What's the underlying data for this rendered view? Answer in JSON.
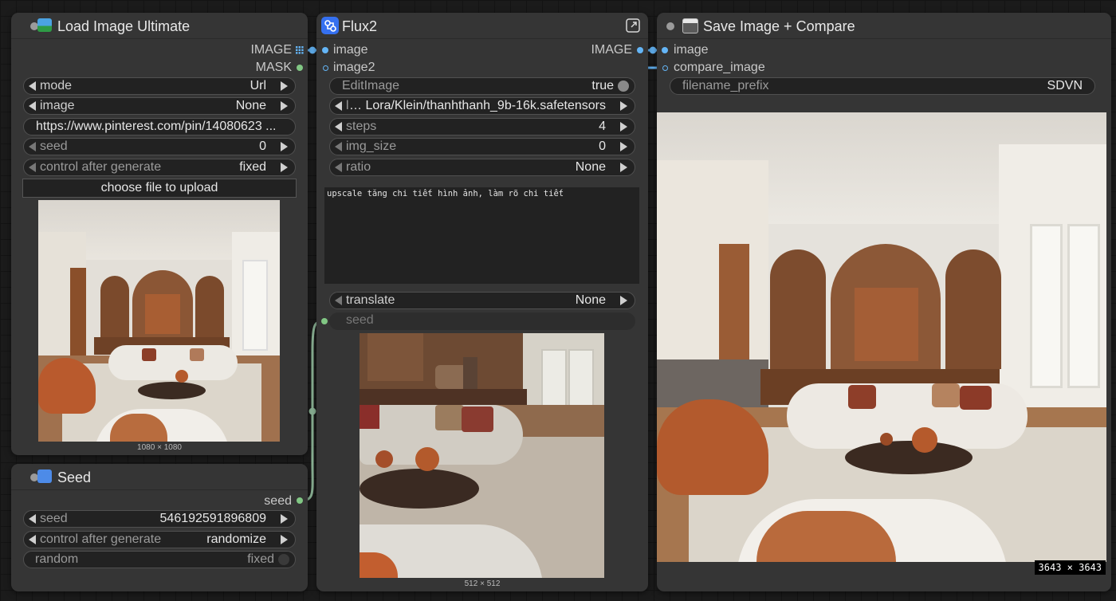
{
  "load_node": {
    "title": "Load Image Ultimate",
    "outputs": [
      "IMAGE",
      "MASK"
    ],
    "mode": {
      "label": "mode",
      "value": "Url"
    },
    "image": {
      "label": "image",
      "value": "None"
    },
    "url": "https://www.pinterest.com/pin/14080623 ...",
    "seed": {
      "label": "seed",
      "value": "0"
    },
    "control": {
      "label": "control after generate",
      "value": "fixed"
    },
    "upload_label": "choose file to upload",
    "preview_size": "1080 × 1080"
  },
  "seed_node": {
    "title": "Seed",
    "output": "seed",
    "seed": {
      "label": "seed",
      "value": "546192591896809"
    },
    "control": {
      "label": "control after generate",
      "value": "randomize"
    },
    "random": {
      "label": "random",
      "value": "fixed"
    }
  },
  "flux_node": {
    "title": "Flux2",
    "inputs": [
      "image",
      "image2"
    ],
    "output": "IMAGE",
    "edit": {
      "label": "EditImage",
      "value": "true"
    },
    "lora": {
      "label": "l",
      "value": "… Lora/Klein/thanhthanh_9b-16k.safetensors"
    },
    "steps": {
      "label": "steps",
      "value": "4"
    },
    "img_size": {
      "label": "img_size",
      "value": "0"
    },
    "ratio": {
      "label": "ratio",
      "value": "None"
    },
    "prompt": "upscale tăng chi tiết hình ảnh, làm rõ chi tiết",
    "translate": {
      "label": "translate",
      "value": "None"
    },
    "seed_input": "seed",
    "preview_size": "512 × 512"
  },
  "save_node": {
    "title": "Save Image + Compare",
    "inputs": [
      "image",
      "compare_image"
    ],
    "filename": {
      "label": "filename_prefix",
      "value": "SDVN"
    },
    "result_size": "3643 × 3643"
  },
  "icons": {
    "load": "picture-emoji-icon",
    "seed": "numbers-emoji-icon",
    "flux": "flux-logo-icon",
    "save": "floppy-disk-icon",
    "expand": "expand-icon"
  },
  "colors": {
    "image_socket": "#64b5f6",
    "mask_socket": "#81c784",
    "link": "#8fb89a",
    "node_bg": "#353535",
    "widget_bg": "#222222"
  }
}
